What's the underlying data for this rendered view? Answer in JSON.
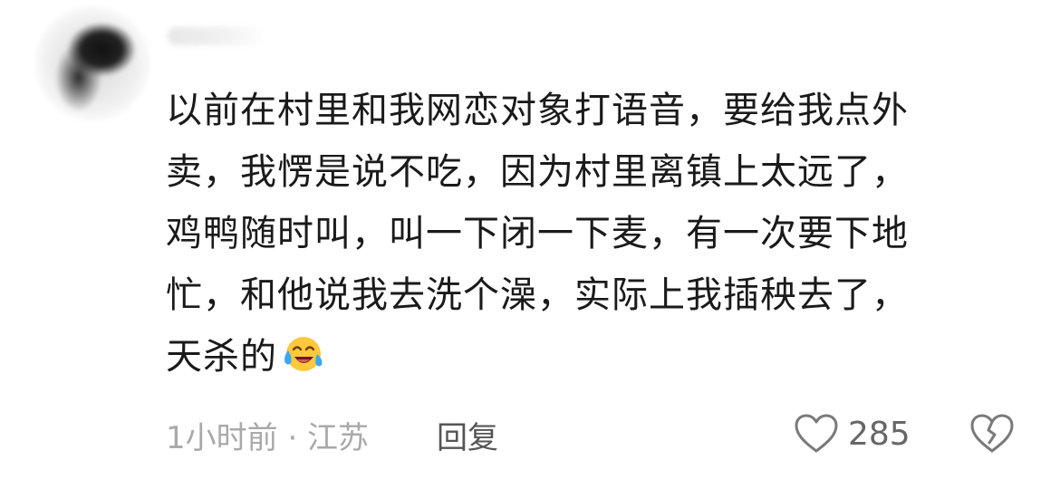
{
  "comment": {
    "lines": [
      "以前在村里和我网恋对象打语音，要给我点外",
      "卖，我愣是说不吃，因为村里离镇上太远了，",
      "鸡鸭随时叫，叫一下闭一下麦，有一次要下地",
      "忙，和他说我去洗个澡，实际上我插秧去了，",
      "天杀的"
    ],
    "emoji": "laughing-crying-emoji"
  },
  "meta": {
    "time_location": "1小时前 · 江苏",
    "reply_label": "回复",
    "like_count": "285"
  },
  "icons": {
    "like": "heart-outline-icon",
    "dislike": "broken-heart-outline-icon"
  }
}
